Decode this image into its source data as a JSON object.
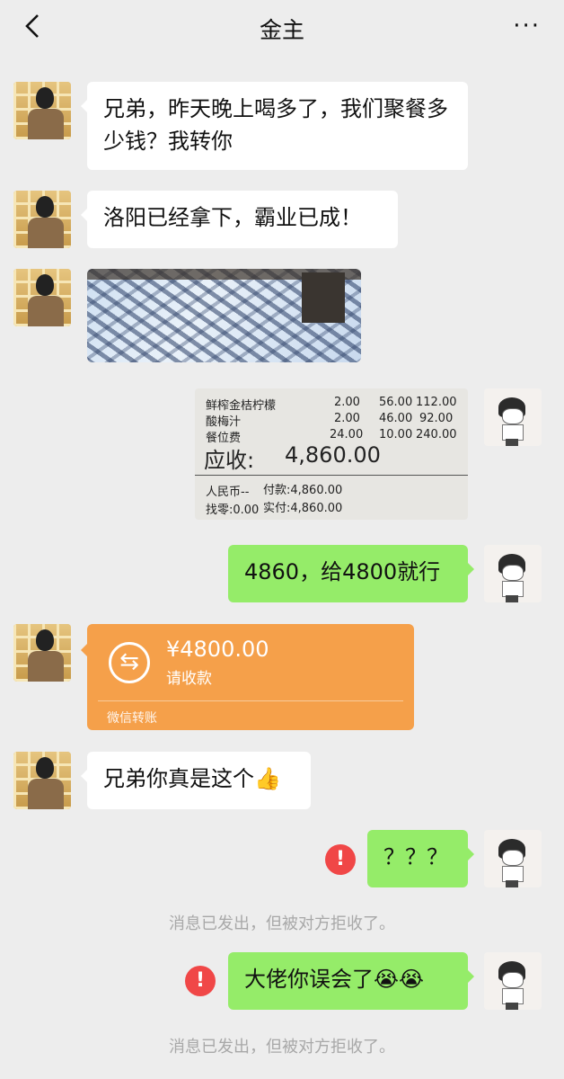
{
  "header": {
    "title": "金主",
    "back_icon": "chevron-left-icon",
    "more_label": "···"
  },
  "messages": {
    "m1": "兄弟，昨天晚上喝多了，我们聚餐多少钱？我转你",
    "m2": "洛阳已经拿下，霸业已成！",
    "m4": "4860，给4800就行",
    "m6_text": "兄弟你真是这个",
    "m6_emoji": "👍",
    "m7": "？？？",
    "m8_text": "大佬你误会了",
    "m8_emoji": "😭😭"
  },
  "receipt": {
    "rows": [
      {
        "name": "鲜榨金桔柠檬",
        "qty": "2.00",
        "price": "56.00",
        "total": "112.00"
      },
      {
        "name": "酸梅汁",
        "qty": "2.00",
        "price": "46.00",
        "total": "92.00"
      },
      {
        "name": "餐位费",
        "qty": "24.00",
        "price": "10.00",
        "total": "240.00"
      }
    ],
    "due_label": "应收:",
    "due_value": "4,860.00",
    "currency": "人民币--",
    "paid": "付款:4,860.00",
    "change": "找零:0.00",
    "actual": "实付:4,860.00"
  },
  "transfer": {
    "amount": "¥4800.00",
    "action": "请收款",
    "footer": "微信转账"
  },
  "notes": {
    "rejected": "消息已发出，但被对方拒收了。"
  },
  "colors": {
    "green_bubble": "#95ec69",
    "transfer": "#f5a04a",
    "error": "#f04747"
  }
}
